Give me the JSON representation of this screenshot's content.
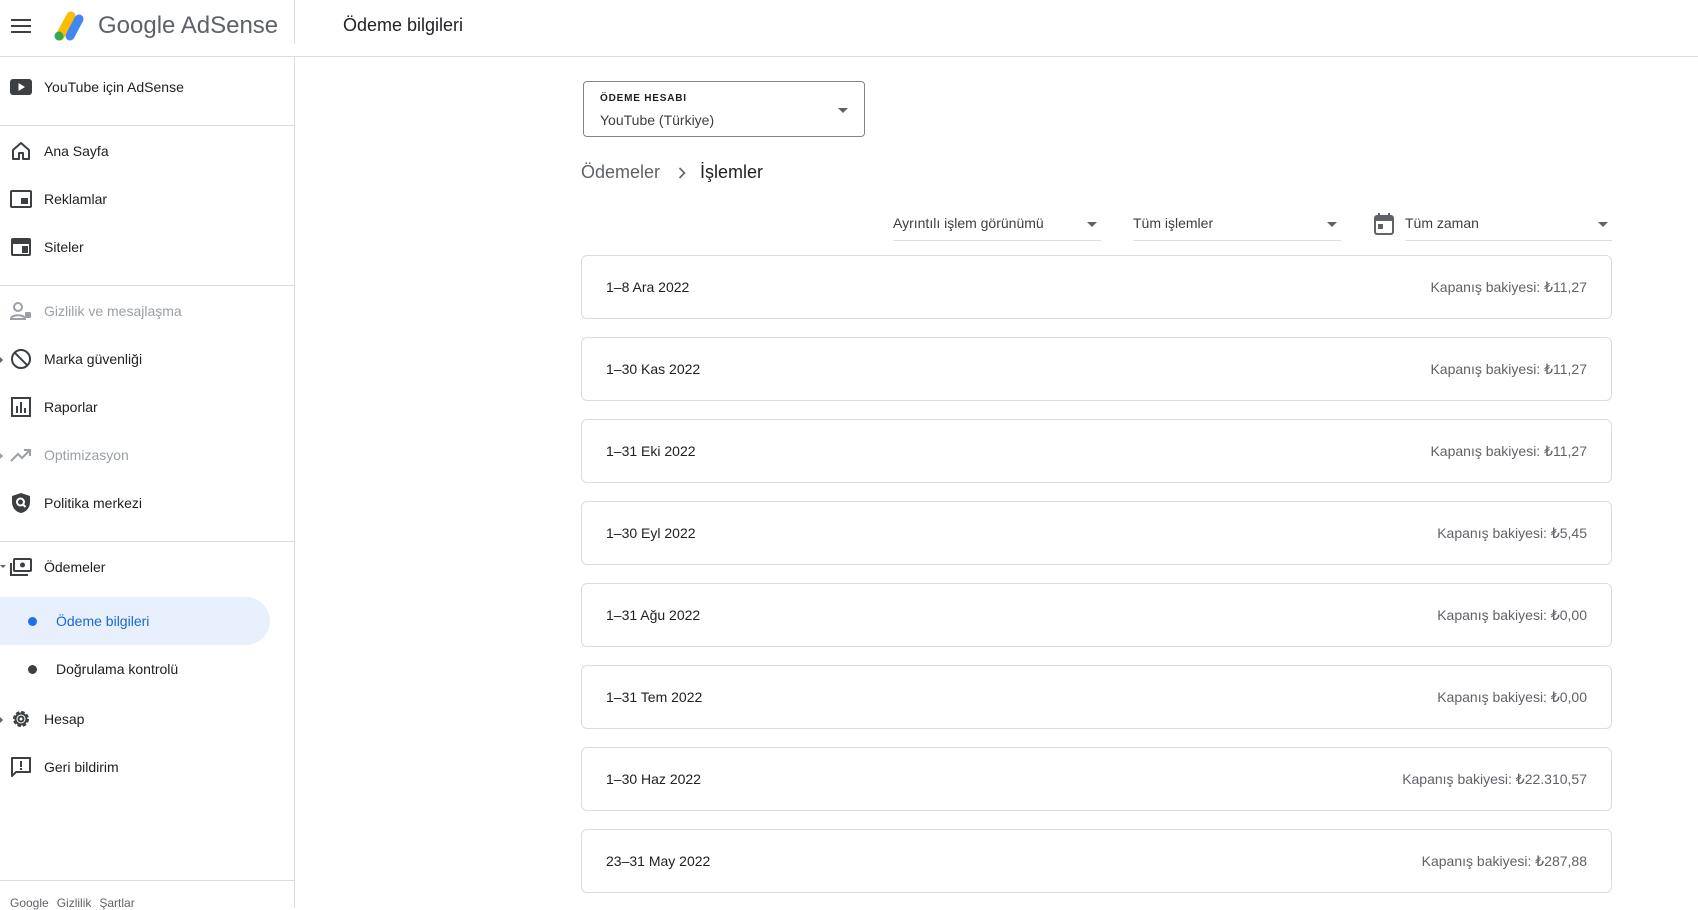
{
  "header": {
    "brand": "Google AdSense",
    "page_title": "Ödeme bilgileri"
  },
  "sidebar": {
    "items": [
      {
        "label": "YouTube için AdSense",
        "icon": "youtube-icon"
      },
      {
        "label": "Ana Sayfa",
        "icon": "home-icon"
      },
      {
        "label": "Reklamlar",
        "icon": "ads-icon"
      },
      {
        "label": "Siteler",
        "icon": "sites-icon"
      },
      {
        "label": "Gizlilik ve mesajlaşma",
        "icon": "privacy-icon",
        "disabled": true
      },
      {
        "label": "Marka güvenliği",
        "icon": "block-icon"
      },
      {
        "label": "Raporlar",
        "icon": "reports-icon"
      },
      {
        "label": "Optimizasyon",
        "icon": "trending-icon",
        "disabled": true
      },
      {
        "label": "Politika merkezi",
        "icon": "policy-icon"
      },
      {
        "label": "Ödemeler",
        "icon": "payments-icon"
      },
      {
        "label": "Hesap",
        "icon": "gear-icon"
      },
      {
        "label": "Geri bildirim",
        "icon": "feedback-icon"
      }
    ],
    "sub_items": [
      {
        "label": "Ödeme bilgileri",
        "active": true
      },
      {
        "label": "Doğrulama kontrolü",
        "active": false
      }
    ],
    "footer": [
      "Google",
      "Gizlilik",
      "Şartlar"
    ]
  },
  "account": {
    "caption": "ÖDEME HESABI",
    "value": "YouTube (Türkiye)"
  },
  "breadcrumb": {
    "parent": "Ödemeler",
    "current": "İşlemler"
  },
  "filters": {
    "view": "Ayrıntılı işlem görünümü",
    "type": "Tüm işlemler",
    "time": "Tüm zaman"
  },
  "transactions": [
    {
      "period": "1–8 Ara 2022",
      "balance": "Kapanış bakiyesi: ₺11,27"
    },
    {
      "period": "1–30 Kas 2022",
      "balance": "Kapanış bakiyesi: ₺11,27"
    },
    {
      "period": "1–31 Eki 2022",
      "balance": "Kapanış bakiyesi: ₺11,27"
    },
    {
      "period": "1–30 Eyl 2022",
      "balance": "Kapanış bakiyesi: ₺5,45"
    },
    {
      "period": "1–31 Ağu 2022",
      "balance": "Kapanış bakiyesi: ₺0,00"
    },
    {
      "period": "1–31 Tem 2022",
      "balance": "Kapanış bakiyesi: ₺0,00"
    },
    {
      "period": "1–30 Haz 2022",
      "balance": "Kapanış bakiyesi: ₺22.310,57"
    },
    {
      "period": "23–31 May 2022",
      "balance": "Kapanış bakiyesi: ₺287,88"
    }
  ],
  "colors": {
    "accent": "#1a73e8",
    "active_bg": "#e8f0fe",
    "border": "#dadce0"
  }
}
